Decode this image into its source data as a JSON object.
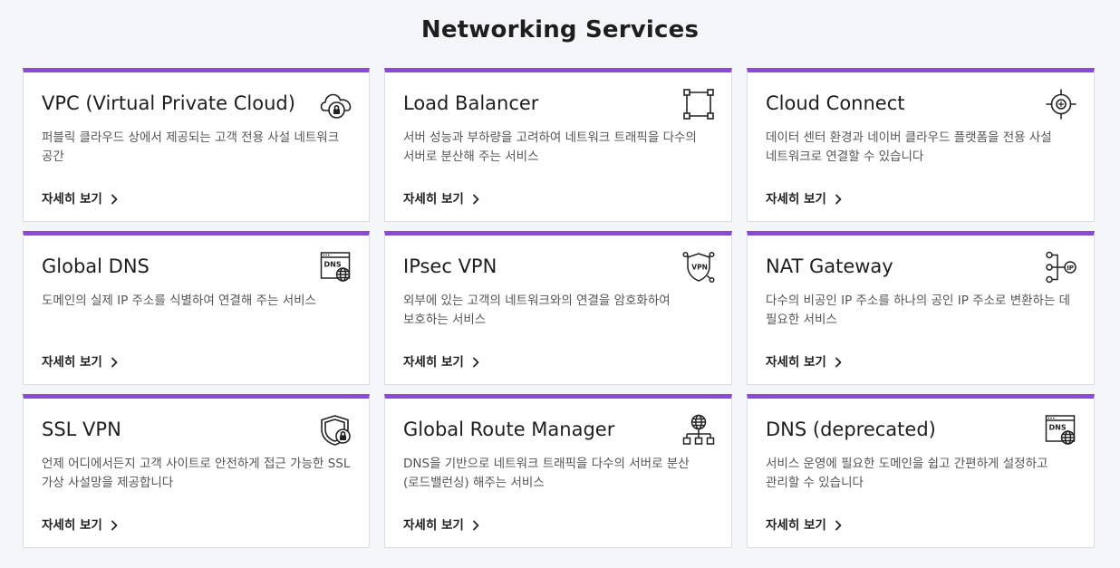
{
  "page": {
    "title": "Networking Services"
  },
  "theme": {
    "accent": "#8a4bd6",
    "background": "#f4f5f8",
    "card_border": "#dcdde2"
  },
  "cards": [
    {
      "title": "VPC (Virtual Private Cloud)",
      "description": "퍼블릭 클라우드 상에서 제공되는 고객 전용 사설 네트워크 공간",
      "link": "자세히 보기",
      "icon": "cloud-lock-icon"
    },
    {
      "title": "Load Balancer",
      "description": "서버 성능과 부하량을 고려하여 네트워크 트래픽을 다수의 서버로 분산해 주는 서비스",
      "link": "자세히 보기",
      "icon": "load-balancer-icon"
    },
    {
      "title": "Cloud Connect",
      "description": "데이터 센터 환경과 네이버 클라우드 플랫폼을 전용 사설 네트워크로 연결할 수 있습니다",
      "link": "자세히 보기",
      "icon": "cloud-connect-icon"
    },
    {
      "title": "Global DNS",
      "description": "도메인의 실제 IP 주소를 식별하여 연결해 주는 서비스",
      "link": "자세히 보기",
      "icon": "dns-globe-icon",
      "icon_label": "DNS"
    },
    {
      "title": "IPsec VPN",
      "description": "외부에 있는 고객의 네트워크와의 연결을 암호화하여 보호하는 서비스",
      "link": "자세히 보기",
      "icon": "vpn-shield-icon",
      "icon_label": "VPN"
    },
    {
      "title": "NAT Gateway",
      "description": "다수의 비공인 IP 주소를 하나의 공인 IP 주소로 변환하는 데 필요한 서비스",
      "link": "자세히 보기",
      "icon": "nat-gateway-icon",
      "icon_label": "IP"
    },
    {
      "title": "SSL VPN",
      "description": "언제 어디에서든지 고객 사이트로 안전하게 접근 가능한 SSL 가상 사설망을 제공합니다",
      "link": "자세히 보기",
      "icon": "shield-lock-icon"
    },
    {
      "title": "Global Route Manager",
      "description": "DNS을 기반으로 네트워크 트래픽을 다수의 서버로 분산(로드밸런싱) 해주는 서비스",
      "link": "자세히 보기",
      "icon": "globe-network-icon"
    },
    {
      "title": "DNS (deprecated)",
      "description": "서비스 운영에 필요한 도메인을 쉽고 간편하게 설정하고 관리할 수 있습니다",
      "link": "자세히 보기",
      "icon": "dns-globe-icon",
      "icon_label": "DNS"
    }
  ]
}
